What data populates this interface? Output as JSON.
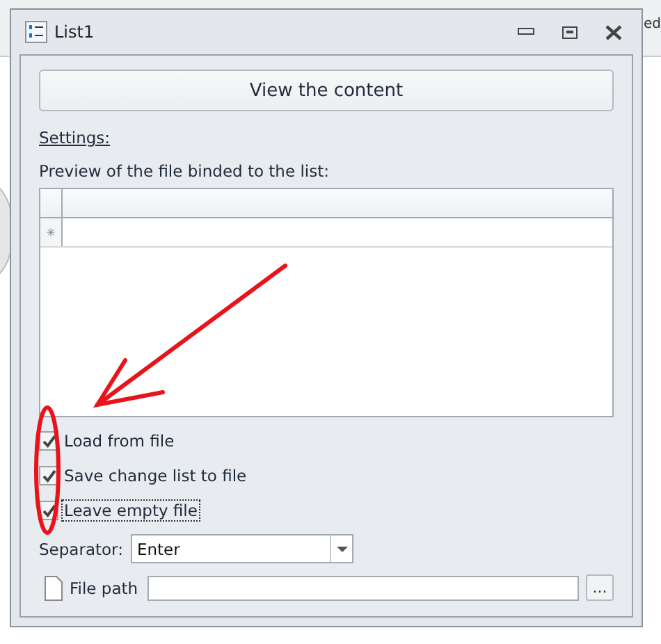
{
  "background": {
    "corner_text": "ed"
  },
  "window": {
    "title": "List1"
  },
  "view_button": "View the content",
  "settings_label": "Settings:",
  "preview_label": "Preview of the file binded to the list:",
  "grid": {
    "new_row_marker": "✳"
  },
  "options": [
    {
      "label": "Load from file",
      "checked": true,
      "focused": false
    },
    {
      "label": "Save change list to file",
      "checked": true,
      "focused": false
    },
    {
      "label": "Leave empty file",
      "checked": true,
      "focused": true
    }
  ],
  "separator": {
    "label": "Separator:",
    "value": "Enter"
  },
  "file_path": {
    "label": "File path",
    "browse": "..."
  }
}
